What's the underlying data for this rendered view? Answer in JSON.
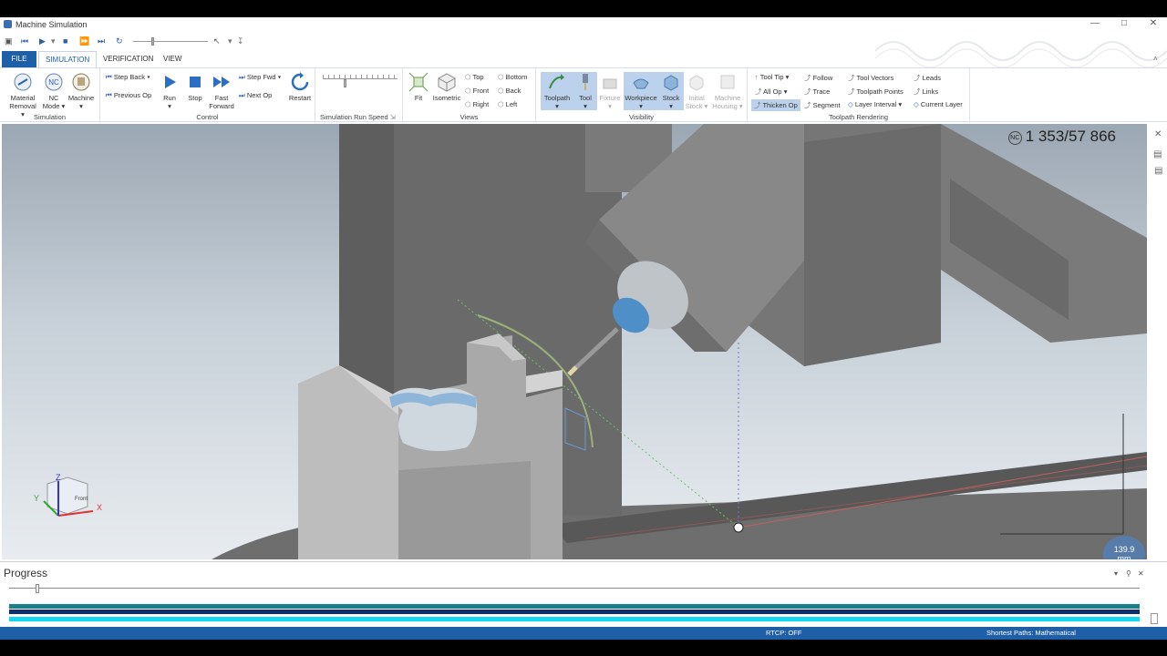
{
  "window": {
    "title": "Machine Simulation"
  },
  "quick_access": {
    "icons": [
      "save-icon",
      "skip-back-icon",
      "play-icon",
      "stop-icon",
      "fast-forward-icon",
      "skip-end-icon",
      "restart-icon",
      "cursor-icon"
    ]
  },
  "tabs": [
    "FILE",
    "SIMULATION",
    "VERIFICATION",
    "VIEW"
  ],
  "active_tab": "SIMULATION",
  "ribbon": {
    "simulation": {
      "label": "Simulation",
      "material_removal": "Material",
      "material_removal_2": "Removal",
      "nc_mode": "NC",
      "nc_mode_2": "Mode",
      "nc_icon_text": "NC",
      "machine": "Machine"
    },
    "control": {
      "label": "Control",
      "step_back": "Step Back",
      "previous_op": "Previous Op",
      "run": "Run",
      "stop": "Stop",
      "fast_forward": "Fast",
      "fast_forward_2": "Forward",
      "step_fwd": "Step Fwd",
      "next_op": "Next Op",
      "restart": "Restart"
    },
    "speed": {
      "label": "Simulation Run Speed",
      "level": 0.28
    },
    "views": {
      "label": "Views",
      "fit": "Fit",
      "isometric": "Isometric",
      "top": "Top",
      "front": "Front",
      "right": "Right",
      "bottom": "Bottom",
      "back": "Back",
      "left": "Left"
    },
    "visibility": {
      "label": "Visibility",
      "toolpath": "Toolpath",
      "tool": "Tool",
      "fixture": "Fixture",
      "workpiece": "Workpiece",
      "stock": "Stock",
      "initial_stock": "Initial",
      "initial_stock_2": "Stock",
      "machine_housing": "Machine",
      "machine_housing_2": "Housing"
    },
    "toolpath_rendering": {
      "label": "Toolpath Rendering",
      "tool_tip": "Tool Tip",
      "all_op": "All Op",
      "thicken_op": "Thicken Op",
      "follow": "Follow",
      "trace": "Trace",
      "segment": "Segment",
      "tool_vectors": "Tool Vectors",
      "toolpath_points": "Toolpath Points",
      "layer_interval": "Layer Interval",
      "leads": "Leads",
      "links": "Links",
      "current_layer": "Current Layer"
    }
  },
  "viewport": {
    "nc_badge": "NC",
    "nc_counter": "1 353/57 866",
    "measure_value": "139.9",
    "measure_unit": "mm",
    "view_cube_label": "Front",
    "axes": {
      "x": "X",
      "y": "Y",
      "z": "Z"
    }
  },
  "progress": {
    "title": "Progress",
    "position": 0.023
  },
  "status": {
    "rtcp": "RTCP: OFF",
    "paths": "Shortest Paths: Mathematical"
  },
  "colors": {
    "accent": "#1f5fa8",
    "highlight": "#bcd2ec",
    "progress_bar_1": "#1a7f8a",
    "progress_bar_2": "#0f2f6e",
    "progress_bar_3": "#14d8f0"
  }
}
